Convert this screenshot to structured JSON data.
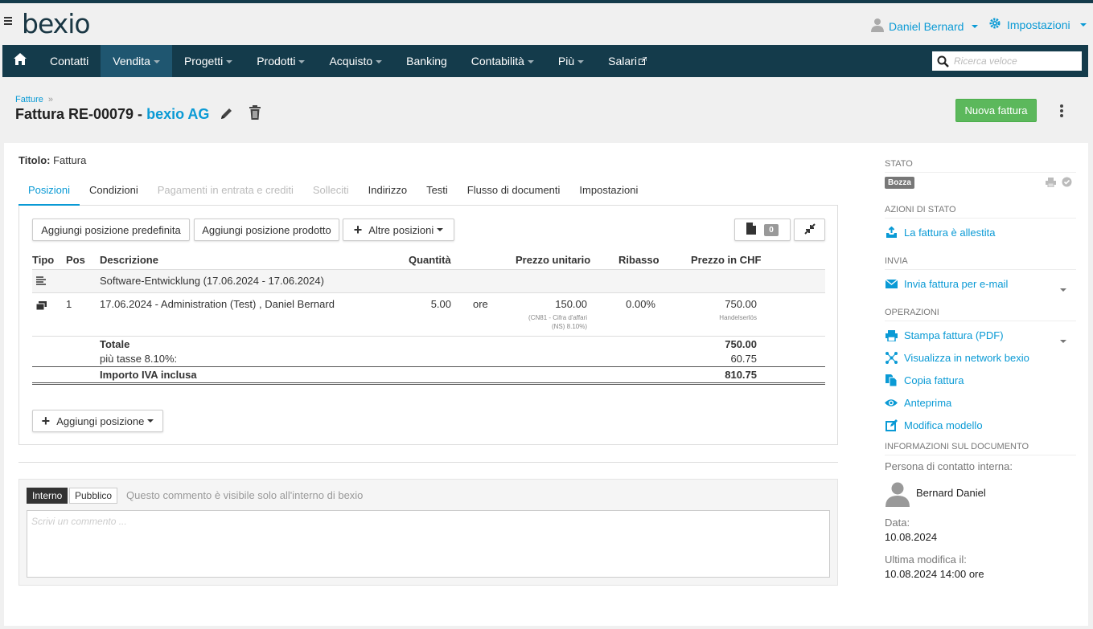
{
  "header": {
    "logo": "bexio",
    "user": "Daniel Bernard",
    "settings": "Impostazioni"
  },
  "nav": {
    "items": [
      {
        "label": "Contatti",
        "dropdown": false
      },
      {
        "label": "Vendita",
        "dropdown": true,
        "active": true
      },
      {
        "label": "Progetti",
        "dropdown": true
      },
      {
        "label": "Prodotti",
        "dropdown": true
      },
      {
        "label": "Acquisto",
        "dropdown": true
      },
      {
        "label": "Banking",
        "dropdown": false
      },
      {
        "label": "Contabilità",
        "dropdown": true
      },
      {
        "label": "Più",
        "dropdown": true
      },
      {
        "label": "Salari",
        "dropdown": false
      }
    ],
    "search_placeholder": "Ricerca veloce"
  },
  "page": {
    "breadcrumb": "Fatture",
    "breadcrumb_sep": "»",
    "title": "Fattura RE-00079 -",
    "company": "bexio AG",
    "new_button": "Nuova fattura"
  },
  "doc": {
    "title_label": "Titolo:",
    "title_value": "Fattura",
    "tabs": [
      {
        "label": "Posizioni",
        "state": "active"
      },
      {
        "label": "Condizioni",
        "state": "normal"
      },
      {
        "label": "Pagamenti in entrata e crediti",
        "state": "disabled"
      },
      {
        "label": "Solleciti",
        "state": "disabled"
      },
      {
        "label": "Indirizzo",
        "state": "normal"
      },
      {
        "label": "Testi",
        "state": "normal"
      },
      {
        "label": "Flusso di documenti",
        "state": "normal"
      },
      {
        "label": "Impostazioni",
        "state": "normal"
      }
    ],
    "buttons": {
      "add_predefined": "Aggiungi posizione predefinita",
      "add_product": "Aggiungi posizione prodotto",
      "other": "Altre posizioni",
      "file_count": "0",
      "add_position": "Aggiungi posizione"
    },
    "columns": {
      "tipo": "Tipo",
      "pos": "Pos",
      "desc": "Descrizione",
      "qty": "Quantità",
      "unit_price": "Prezzo unitario",
      "discount": "Ribasso",
      "price": "Prezzo in CHF"
    },
    "text_row": "Software-Entwicklung (17.06.2024 - 17.06.2024)",
    "item": {
      "pos": "1",
      "desc": "17.06.2024 - Administration (Test) , Daniel Bernard",
      "qty": "5.00",
      "unit": "ore",
      "unit_price": "150.00",
      "account_note_1": "(CN81 - Cifra d'affari",
      "account_note_2": "(NS) 8.10%)",
      "discount": "0.00%",
      "price": "750.00",
      "account": "Handelserlös"
    },
    "totals": {
      "total_label": "Totale",
      "total_value": "750.00",
      "tax_label": "più tasse 8.10%:",
      "tax_value": "60.75",
      "gross_label": "Importo IVA inclusa",
      "gross_value": "810.75"
    }
  },
  "comment": {
    "tab_internal": "Interno",
    "tab_public": "Pubblico",
    "hint": "Questo commento è visibile solo all'interno di bexio",
    "placeholder": "Scrivi un commento ..."
  },
  "sidebar": {
    "status_header": "Stato",
    "status": "Bozza",
    "actions_header": "Azioni di stato",
    "action_ready": "La fattura è allestita",
    "send_header": "Invia",
    "send_email": "Invia fattura per e-mail",
    "ops_header": "Operazioni",
    "print": "Stampa fattura (PDF)",
    "network": "Visualizza in network bexio",
    "copy": "Copia fattura",
    "preview": "Anteprima",
    "template": "Modifica modello",
    "info_header": "Informazioni sul documento",
    "contact_label": "Persona di contatto interna:",
    "contact_name": "Bernard Daniel",
    "date_label": "Data:",
    "date_value": "10.08.2024",
    "modified_label": "Ultima modifica il:",
    "modified_value": "10.08.2024 14:00 ore"
  },
  "colors": {
    "navbar": "#143b4b",
    "accent": "#0a9ad5",
    "success": "#5cb85c"
  }
}
